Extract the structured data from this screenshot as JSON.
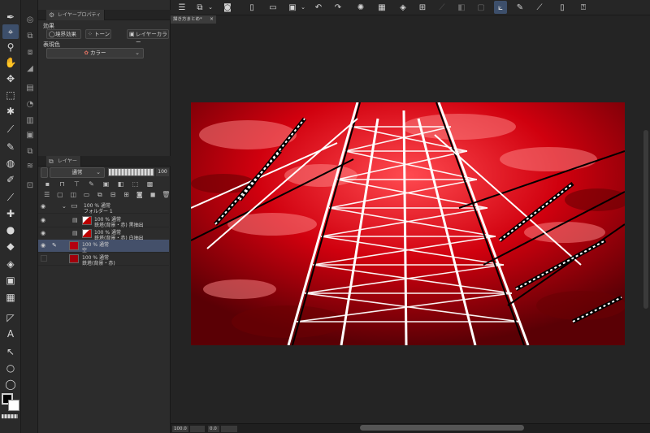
{
  "toolbar": {
    "tools": [
      "pen-icon",
      "magnifier-icon",
      "hand-icon",
      "move-icon",
      "selection-icon",
      "wand-icon",
      "eyedropper-icon",
      "pen-nib-icon",
      "pencil-icon",
      "airbrush-icon",
      "brush-icon",
      "decoration-icon",
      "eraser-icon",
      "fill-icon",
      "gradient-icon",
      "frame-icon",
      "ruler-icon",
      "text-icon",
      "balloon-icon",
      "lasso-icon",
      "chat-icon"
    ]
  },
  "layer_property": {
    "tab_label": "レイヤープロパティ",
    "effect_label": "効果",
    "effect_buttons": [
      "境界効果",
      "トーン",
      "レイヤーカラー"
    ],
    "expression_color_label": "表現色",
    "expression_color_value": "カラー"
  },
  "layers_panel": {
    "tab_label": "レイヤー",
    "blend_mode": "通常",
    "opacity": "100",
    "layers": [
      {
        "line1": "100 % 通常",
        "line2": "フォルダー 1",
        "kind": "folder",
        "visible": true,
        "selected": false
      },
      {
        "line1": "100 % 通常",
        "line2": "鉄塔(背景・赤) 黒抽出",
        "kind": "layer",
        "visible": true,
        "selected": false
      },
      {
        "line1": "100 % 通常",
        "line2": "鉄塔(背景・赤) 白抽出",
        "kind": "layer",
        "visible": true,
        "selected": false
      },
      {
        "line1": "100 % 通常",
        "line2": "空",
        "kind": "layer",
        "visible": true,
        "selected": true
      },
      {
        "line1": "100 % 通常",
        "line2": "鉄塔(背景・赤)",
        "kind": "layer",
        "visible": false,
        "selected": false
      }
    ]
  },
  "document": {
    "tab_title": "描き方まとめ*",
    "close": "×"
  },
  "status": {
    "zoom": "100.0",
    "position": "0.0"
  },
  "colors": {
    "main": "#000000",
    "sub": "#ffffff",
    "accent": "#3d4f6b",
    "artwork_red": "#c4000c"
  }
}
